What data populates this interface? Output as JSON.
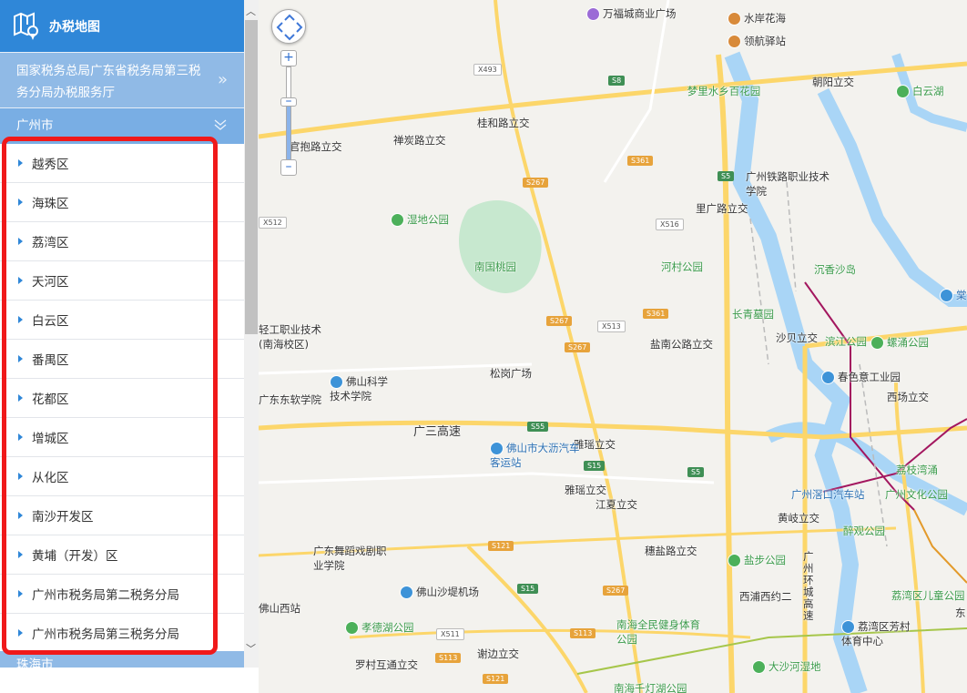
{
  "sidebar": {
    "title": "办税地图",
    "office": "国家税务总局广东省税务局第三税务分局办税服务厅",
    "city": "广州市",
    "districts": [
      "越秀区",
      "海珠区",
      "荔湾区",
      "天河区",
      "白云区",
      "番禺区",
      "花都区",
      "增城区",
      "从化区",
      "南沙开发区",
      "黄埔（开发）区",
      "广州市税务局第二税务分局",
      "广州市税务局第三税务分局"
    ],
    "next_city": "珠海市"
  },
  "colors": {
    "header": "#2f87d8",
    "highlight": "#f0191a"
  },
  "map": {
    "labels": {
      "wanfu": "万福城商业广场",
      "shuian": "水岸花海",
      "linghang": "领航驿站",
      "chaoyang": "朝阳立交",
      "baiyunhu": "白云湖",
      "mengli": "梦里水乡百花园",
      "guibao": "官抱路立交",
      "chanyan": "禅炭路立交",
      "guihe": "桂和路立交",
      "tielu": "广州铁路职业技术学院",
      "liguang": "里广路立交",
      "shidi": "湿地公园",
      "nanguo": "南国桃园",
      "hecun": "河村公园",
      "chenxiang": "沉香沙岛",
      "qinggong": "轻工职业技术(南海校区)",
      "changqing": "长青墓园",
      "shabei": "沙贝立交",
      "binjiang": "滨江公园",
      "luoyong": "螺涌公园",
      "yannan": "盐南公路立交",
      "songgang": "松岗广场",
      "chunse": "春色意工业园",
      "xichang": "西场立交",
      "fokexue": "佛山科学技术学院",
      "dongruan": "广东东软学院",
      "guangsan": "广三高速",
      "yayao": "雅瑶立交",
      "dali": "佛山市大沥汽车客运站",
      "yayao2": "雅瑶立交",
      "jiangxia": "江夏立交",
      "lizhi": "荔枝湾涌",
      "jiaokou": "广州滘口汽车站",
      "wenhua": "广州文化公园",
      "huangqi": "黄岐立交",
      "zuiguan": "醉观公园",
      "wudao": "广东舞蹈戏剧职业学院",
      "suiyan": "穗盐路立交",
      "yanbu": "盐步公园",
      "huancheng": "广州环城高速",
      "shadi": "佛山沙堤机场",
      "xipu": "西浦西约二",
      "fsxi": "佛山西站",
      "xiaode": "孝德湖公园",
      "nanhaiquan": "南海全民健身体育公园",
      "ertong": "荔湾区儿童公园",
      "fangcun": "荔湾区芳村体育中心",
      "luocun": "罗村互通立交",
      "xiebian": "谢边立交",
      "dasha": "大沙河湿地",
      "qiande": "南海千灯湖公园",
      "dong": "东",
      "tang": "棠"
    },
    "shields": [
      "X493",
      "S8",
      "S361",
      "S267",
      "S5",
      "X516",
      "X512",
      "X513",
      "S267",
      "S361",
      "S267",
      "S55",
      "S15",
      "S5",
      "S121",
      "S15",
      "S267",
      "X511",
      "S113",
      "S113",
      "S121"
    ]
  }
}
